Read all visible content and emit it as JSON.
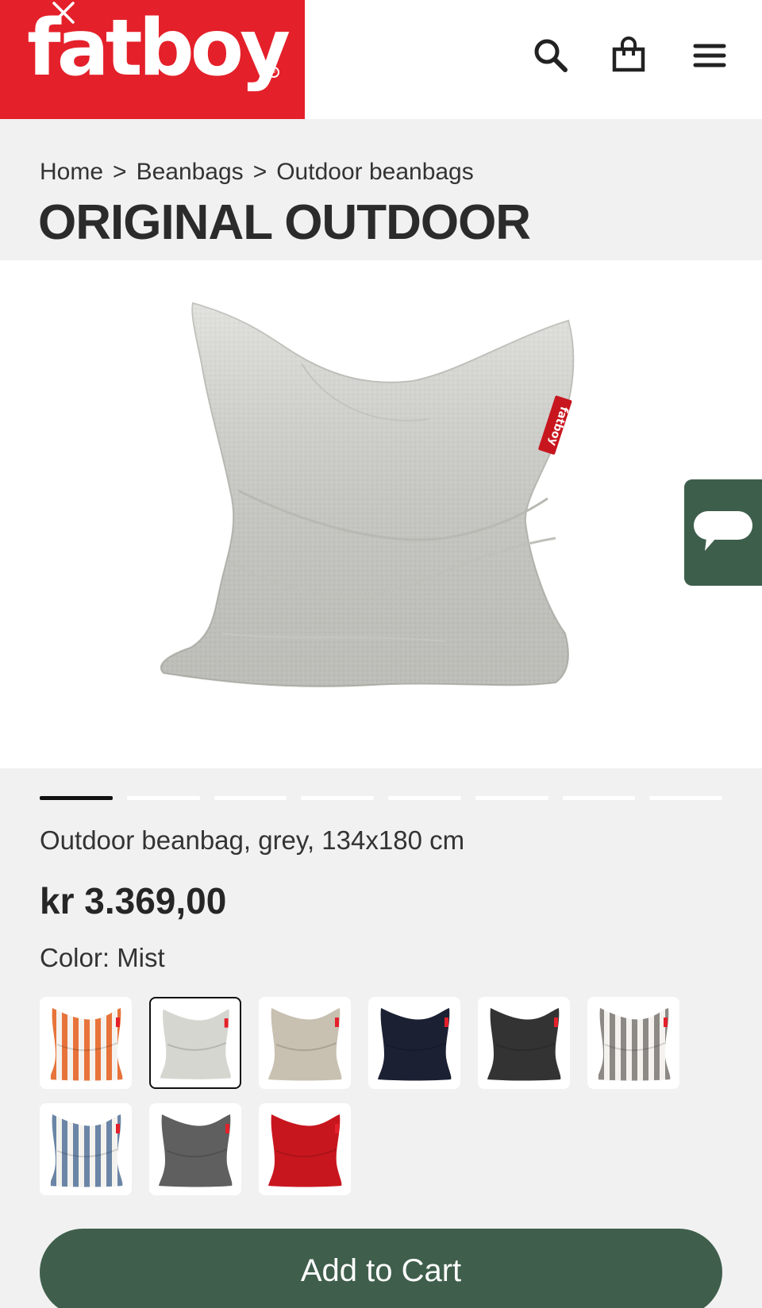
{
  "header": {
    "logo_text": "fatboy",
    "logo_mark": "®",
    "icons": [
      "close-icon",
      "search-icon",
      "shopping-bag-icon",
      "menu-icon"
    ]
  },
  "breadcrumb": {
    "items": [
      "Home",
      "Beanbags",
      "Outdoor beanbags"
    ],
    "separator": ">"
  },
  "product": {
    "title": "ORIGINAL OUTDOOR",
    "image_tag": "fatboy",
    "description": "Outdoor beanbag, grey, 134x180 cm",
    "price": "kr 3.369,00",
    "color_label": "Color: Mist",
    "gallery_count": 8,
    "gallery_active_index": 0
  },
  "swatches": [
    {
      "name": "orange-stripe",
      "color": "#e8733a",
      "pattern": "stripe",
      "selected": false
    },
    {
      "name": "mist",
      "color": "#d6d6d1",
      "pattern": "solid",
      "selected": true
    },
    {
      "name": "sand",
      "color": "#c8c0b0",
      "pattern": "solid",
      "selected": false
    },
    {
      "name": "navy",
      "color": "#1b2033",
      "pattern": "solid",
      "selected": false
    },
    {
      "name": "charcoal",
      "color": "#333333",
      "pattern": "solid",
      "selected": false
    },
    {
      "name": "grey-stripe",
      "color": "#8d8a86",
      "pattern": "stripe",
      "selected": false
    },
    {
      "name": "blue-stripe",
      "color": "#6b85a6",
      "pattern": "stripe",
      "selected": false
    },
    {
      "name": "grey",
      "color": "#5f5f5f",
      "pattern": "solid",
      "selected": false
    },
    {
      "name": "red",
      "color": "#c8161e",
      "pattern": "solid",
      "selected": false
    }
  ],
  "cta": {
    "add_to_cart": "Add to Cart"
  },
  "colors": {
    "brand_red": "#e4202a",
    "accent_green": "#3f5f4c",
    "background": "#f1f1f1"
  }
}
